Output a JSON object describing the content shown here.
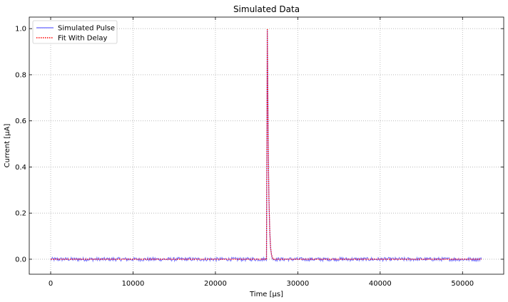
{
  "chart_data": {
    "type": "line",
    "title": "Simulated Data",
    "xlabel": "Time [µs]",
    "ylabel": "Current [µA]",
    "xlim": [
      -2600,
      55000
    ],
    "ylim": [
      -0.065,
      1.05
    ],
    "xticks": [
      0,
      10000,
      20000,
      30000,
      40000,
      50000
    ],
    "yticks": [
      0.0,
      0.2,
      0.4,
      0.6,
      0.8,
      1.0
    ],
    "xtick_labels": [
      "0",
      "10000",
      "20000",
      "30000",
      "40000",
      "50000"
    ],
    "ytick_labels": [
      "0.0",
      "0.2",
      "0.4",
      "0.6",
      "0.8",
      "1.0"
    ],
    "grid": true,
    "legend_position": "top-left",
    "series": [
      {
        "name": "Simulated Pulse",
        "color": "#7f7fff",
        "style": "solid",
        "noise_amplitude": 0.008,
        "x": [
          0,
          26200,
          26250,
          26300,
          26350,
          26400,
          26450,
          26500,
          26600,
          26700,
          26800,
          27000,
          27500,
          52300
        ],
        "y": [
          0.0,
          0.0,
          0.5,
          1.0,
          0.78,
          0.55,
          0.38,
          0.26,
          0.12,
          0.05,
          0.02,
          0.0,
          0.0,
          0.0
        ]
      },
      {
        "name": "Fit With Delay",
        "color": "#ff0000",
        "style": "dotted",
        "noise_amplitude": 0,
        "x": [
          0,
          26200,
          26250,
          26300,
          26350,
          26400,
          26450,
          26500,
          26600,
          26700,
          26800,
          27000,
          27500,
          52300
        ],
        "y": [
          0.0,
          0.0,
          0.5,
          1.0,
          0.78,
          0.55,
          0.38,
          0.26,
          0.12,
          0.05,
          0.02,
          0.0,
          0.0,
          0.0
        ]
      }
    ]
  }
}
